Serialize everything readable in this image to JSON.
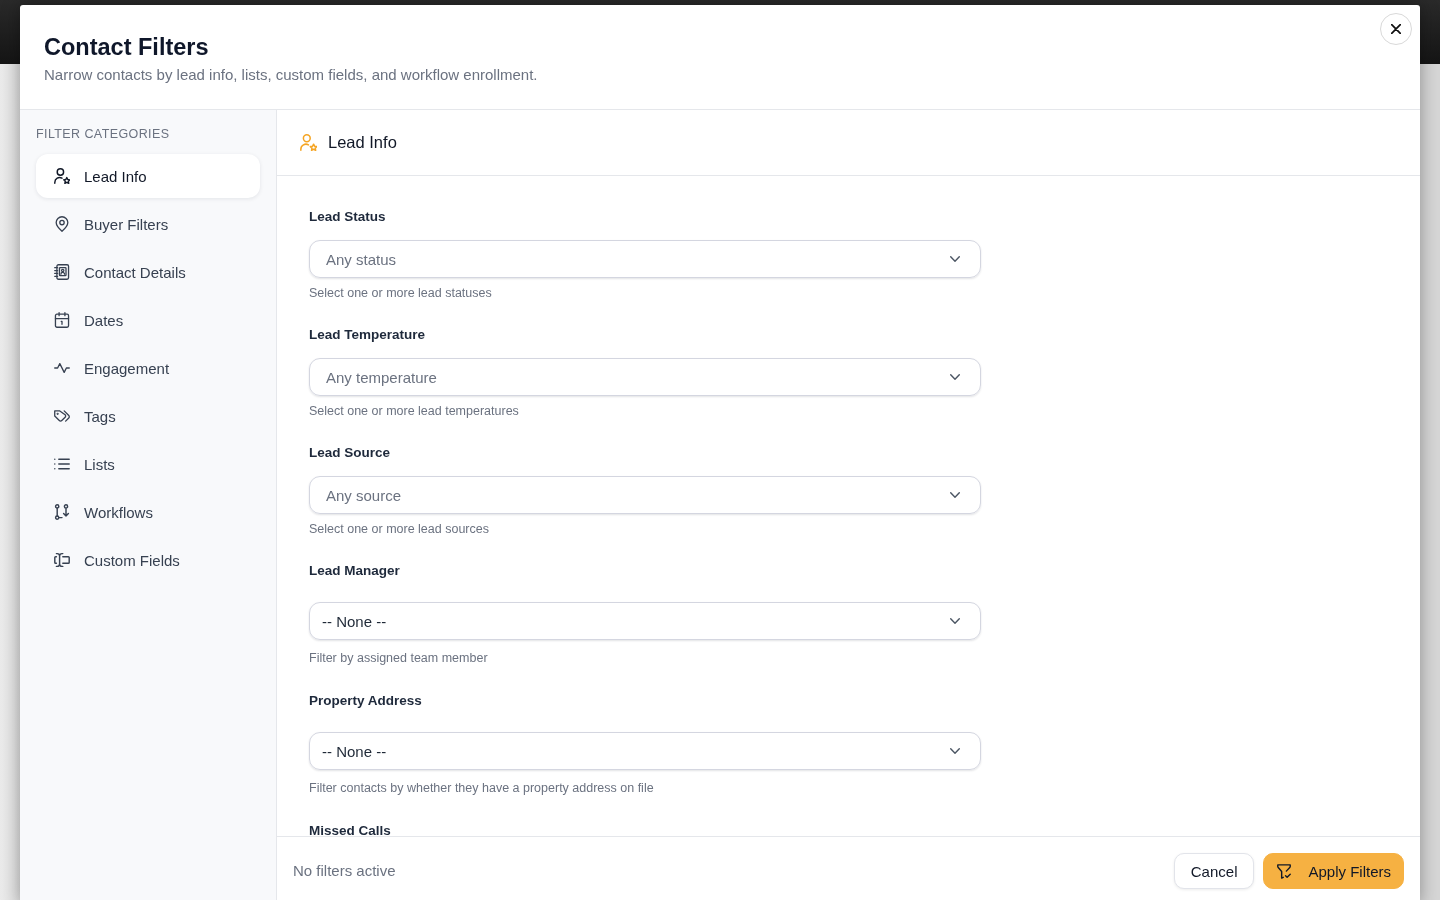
{
  "modal": {
    "title": "Contact Filters",
    "subtitle": "Narrow contacts by lead info, lists, custom fields, and workflow enrollment."
  },
  "sidebar": {
    "heading": "FILTER CATEGORIES",
    "items": [
      {
        "label": "Lead Info",
        "selected": true
      },
      {
        "label": "Buyer Filters",
        "selected": false
      },
      {
        "label": "Contact Details",
        "selected": false
      },
      {
        "label": "Dates",
        "selected": false
      },
      {
        "label": "Engagement",
        "selected": false
      },
      {
        "label": "Tags",
        "selected": false
      },
      {
        "label": "Lists",
        "selected": false
      },
      {
        "label": "Workflows",
        "selected": false
      },
      {
        "label": "Custom Fields",
        "selected": false
      }
    ]
  },
  "section": {
    "title": "Lead Info"
  },
  "fields": [
    {
      "kind": "multiselect",
      "label": "Lead Status",
      "placeholder": "Any status",
      "help": "Select one or more lead statuses"
    },
    {
      "kind": "multiselect",
      "label": "Lead Temperature",
      "placeholder": "Any temperature",
      "help": "Select one or more lead temperatures"
    },
    {
      "kind": "multiselect",
      "label": "Lead Source",
      "placeholder": "Any source",
      "help": "Select one or more lead sources"
    },
    {
      "kind": "select",
      "label": "Lead Manager",
      "value": "-- None --",
      "help": "Filter by assigned team member"
    },
    {
      "kind": "select",
      "label": "Property Address",
      "value": "-- None --",
      "help": "Filter contacts by whether they have a property address on file"
    },
    {
      "label": "Missed Calls"
    }
  ],
  "footer": {
    "status": "No filters active",
    "buttons": [
      {
        "kind": "secondary",
        "label": "Cancel"
      },
      {
        "kind": "primary",
        "label": "Apply Filters"
      }
    ]
  }
}
